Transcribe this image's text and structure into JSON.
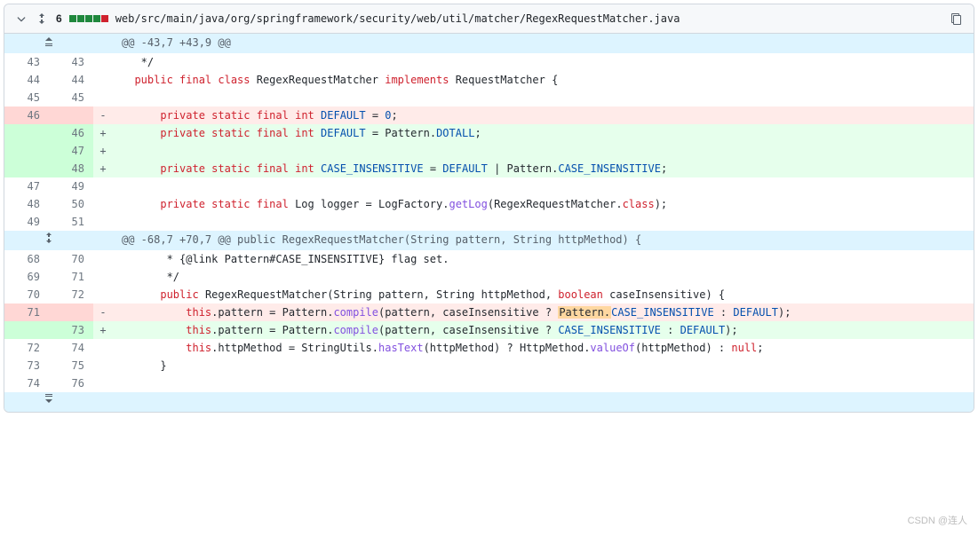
{
  "header": {
    "change_count": "6",
    "diffstat": [
      "add",
      "add",
      "add",
      "add",
      "del"
    ],
    "file_path": "web/src/main/java/org/springframework/security/web/util/matcher/RegexRequestMatcher.java"
  },
  "hunks": [
    {
      "header": "@@ -43,7 +43,9 @@"
    },
    {
      "header": "@@ -68,7 +70,7 @@ public RegexRequestMatcher(String pattern, String httpMethod) {"
    }
  ],
  "lines": [
    {
      "kind": "hunk",
      "expand": "up",
      "text_ref": "hunks.0.header"
    },
    {
      "kind": "ctx",
      "old": "43",
      "new": "43",
      "tokens": [
        [
          "   */",
          "str"
        ]
      ]
    },
    {
      "kind": "ctx",
      "old": "44",
      "new": "44",
      "tokens": [
        [
          "  ",
          ""
        ],
        [
          "public final class",
          "k"
        ],
        [
          " RegexRequestMatcher ",
          "str"
        ],
        [
          "implements",
          "k"
        ],
        [
          " RequestMatcher {",
          "str"
        ]
      ]
    },
    {
      "kind": "ctx",
      "old": "45",
      "new": "45",
      "tokens": [
        [
          "",
          ""
        ]
      ]
    },
    {
      "kind": "del",
      "old": "46",
      "new": "",
      "tokens": [
        [
          "      ",
          ""
        ],
        [
          "private static final",
          "k"
        ],
        [
          " ",
          ""
        ],
        [
          "int",
          "k"
        ],
        [
          " ",
          ""
        ],
        [
          "DEFAULT",
          "const"
        ],
        [
          " = ",
          ""
        ],
        [
          "0",
          "const"
        ],
        [
          ";",
          ""
        ]
      ]
    },
    {
      "kind": "add",
      "old": "",
      "new": "46",
      "tokens": [
        [
          "      ",
          ""
        ],
        [
          "private static final",
          "k"
        ],
        [
          " ",
          ""
        ],
        [
          "int",
          "k"
        ],
        [
          " ",
          ""
        ],
        [
          "DEFAULT",
          "const"
        ],
        [
          " = Pattern.",
          ""
        ],
        [
          "DOTALL",
          "const"
        ],
        [
          ";",
          ""
        ]
      ]
    },
    {
      "kind": "add",
      "old": "",
      "new": "47",
      "tokens": [
        [
          "",
          ""
        ]
      ]
    },
    {
      "kind": "add",
      "old": "",
      "new": "48",
      "tokens": [
        [
          "      ",
          ""
        ],
        [
          "private static final",
          "k"
        ],
        [
          " ",
          ""
        ],
        [
          "int",
          "k"
        ],
        [
          " ",
          ""
        ],
        [
          "CASE_INSENSITIVE",
          "const"
        ],
        [
          " = ",
          ""
        ],
        [
          "DEFAULT",
          "const"
        ],
        [
          " | Pattern.",
          ""
        ],
        [
          "CASE_INSENSITIVE",
          "const"
        ],
        [
          ";",
          ""
        ]
      ]
    },
    {
      "kind": "ctx",
      "old": "47",
      "new": "49",
      "tokens": [
        [
          "",
          ""
        ]
      ]
    },
    {
      "kind": "ctx",
      "old": "48",
      "new": "50",
      "tokens": [
        [
          "      ",
          ""
        ],
        [
          "private static final",
          "k"
        ],
        [
          " Log logger = LogFactory.",
          ""
        ],
        [
          "getLog",
          "fn"
        ],
        [
          "(RegexRequestMatcher.",
          ""
        ],
        [
          "class",
          "k"
        ],
        [
          ");",
          ""
        ]
      ]
    },
    {
      "kind": "ctx",
      "old": "49",
      "new": "51",
      "tokens": [
        [
          "",
          ""
        ]
      ]
    },
    {
      "kind": "hunk",
      "expand": "mid",
      "text_ref": "hunks.1.header"
    },
    {
      "kind": "ctx",
      "old": "68",
      "new": "70",
      "tokens": [
        [
          "       * {@link Pattern#CASE_INSENSITIVE} flag set.",
          "str"
        ]
      ]
    },
    {
      "kind": "ctx",
      "old": "69",
      "new": "71",
      "tokens": [
        [
          "       */",
          "str"
        ]
      ]
    },
    {
      "kind": "ctx",
      "old": "70",
      "new": "72",
      "tokens": [
        [
          "      ",
          ""
        ],
        [
          "public",
          "k"
        ],
        [
          " RegexRequestMatcher(String pattern, String httpMethod, ",
          ""
        ],
        [
          "boolean",
          "k"
        ],
        [
          " caseInsensitive) {",
          ""
        ]
      ]
    },
    {
      "kind": "del",
      "old": "71",
      "new": "",
      "tokens": [
        [
          "          ",
          ""
        ],
        [
          "this",
          "k"
        ],
        [
          ".pattern = Pattern.",
          ""
        ],
        [
          "compile",
          "fn"
        ],
        [
          "(pattern, caseInsensitive ? ",
          ""
        ],
        [
          "Pattern.",
          "hl"
        ],
        [
          "CASE_INSENSITIVE",
          "const"
        ],
        [
          " : ",
          ""
        ],
        [
          "DEFAULT",
          "const"
        ],
        [
          ");",
          ""
        ]
      ]
    },
    {
      "kind": "add",
      "old": "",
      "new": "73",
      "tokens": [
        [
          "          ",
          ""
        ],
        [
          "this",
          "k"
        ],
        [
          ".pattern = Pattern.",
          ""
        ],
        [
          "compile",
          "fn"
        ],
        [
          "(pattern, caseInsensitive ? ",
          ""
        ],
        [
          "CASE_INSENSITIVE",
          "const"
        ],
        [
          " : ",
          ""
        ],
        [
          "DEFAULT",
          "const"
        ],
        [
          ");",
          ""
        ]
      ]
    },
    {
      "kind": "ctx",
      "old": "72",
      "new": "74",
      "tokens": [
        [
          "          ",
          ""
        ],
        [
          "this",
          "k"
        ],
        [
          ".httpMethod = StringUtils.",
          ""
        ],
        [
          "hasText",
          "fn"
        ],
        [
          "(httpMethod) ? HttpMethod.",
          ""
        ],
        [
          "valueOf",
          "fn"
        ],
        [
          "(httpMethod) : ",
          ""
        ],
        [
          "null",
          "k"
        ],
        [
          ";",
          ""
        ]
      ]
    },
    {
      "kind": "ctx",
      "old": "73",
      "new": "75",
      "tokens": [
        [
          "      }",
          "str"
        ]
      ]
    },
    {
      "kind": "ctx",
      "old": "74",
      "new": "76",
      "tokens": [
        [
          "",
          ""
        ]
      ]
    },
    {
      "kind": "hunk",
      "expand": "down",
      "text_ref": ""
    }
  ],
  "watermark": "CSDN @连人"
}
